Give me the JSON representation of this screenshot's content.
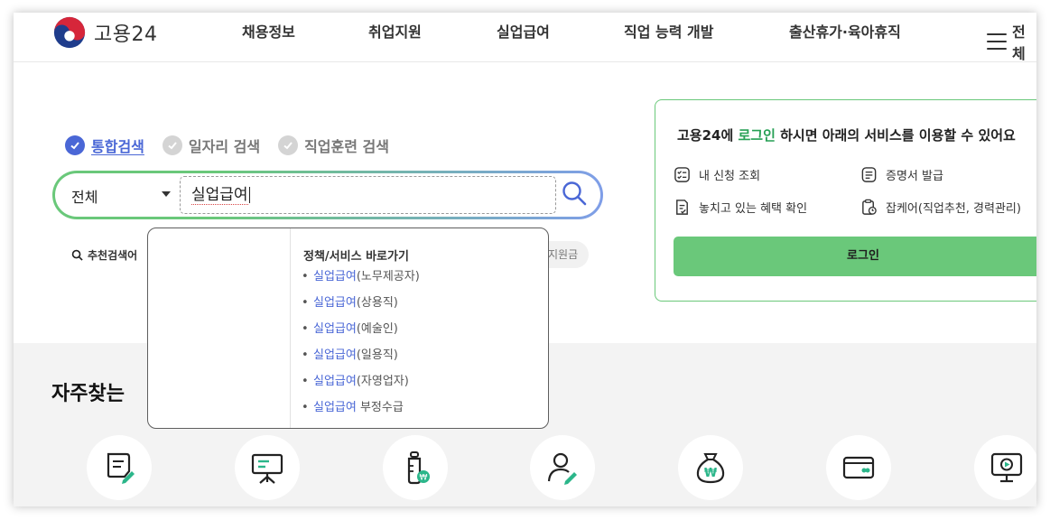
{
  "header": {
    "logo_text": "고용24",
    "nav": [
      "채용정보",
      "취업지원",
      "실업급여",
      "직업 능력 개발",
      "출산휴가·육아휴직"
    ],
    "menu_label": "전체"
  },
  "search": {
    "tabs": [
      {
        "label": "통합검색",
        "active": true
      },
      {
        "label": "일자리 검색",
        "active": false
      },
      {
        "label": "직업훈련 검색",
        "active": false
      }
    ],
    "scope_value": "전체",
    "query": "실업급여",
    "recommend_label": "추천검색어",
    "recommend_chip_partial": "지원금"
  },
  "dropdown": {
    "title": "정책/서비스 바로가기",
    "items": [
      {
        "highlight": "실업급여",
        "rest": "(노무제공자)"
      },
      {
        "highlight": "실업급여",
        "rest": "(상용직)"
      },
      {
        "highlight": "실업급여",
        "rest": "(예술인)"
      },
      {
        "highlight": "실업급여",
        "rest": "(일용직)"
      },
      {
        "highlight": "실업급여",
        "rest": "(자영업자)"
      },
      {
        "highlight": "실업급여",
        "rest": " 부정수급"
      }
    ]
  },
  "login_card": {
    "title_prefix": "고용24에 ",
    "title_link": "로그인",
    "title_suffix": " 하시면 아래의 서비스를 이용할 수 있어요",
    "items": [
      "내 신청 조회",
      "증명서 발급",
      "놓치고 있는 혜택 확인",
      "잡케어(직업추천, 경력관리)"
    ],
    "button_label": "로그인"
  },
  "frequent": {
    "title_partial": "자주찾는",
    "icons": [
      "document-pen-icon",
      "presentation-board-icon",
      "baby-bottle-won-icon",
      "person-edit-icon",
      "money-bag-won-icon",
      "card-icon",
      "monitor-play-icon"
    ]
  },
  "colors": {
    "accent_blue": "#4a67d6",
    "accent_green": "#6ac87a",
    "icon_teal": "#2bb68a"
  }
}
